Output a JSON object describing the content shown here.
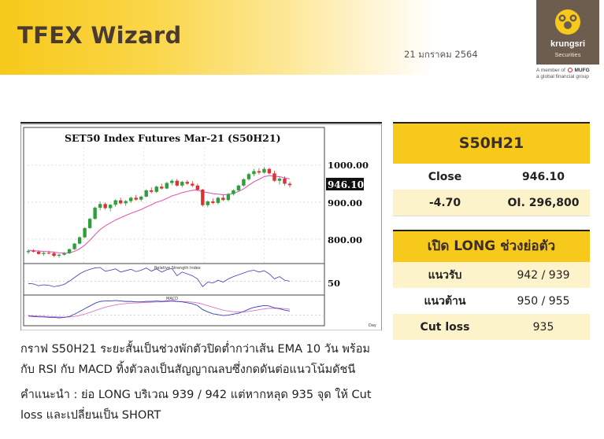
{
  "header": {
    "title": "TFEX Wizard",
    "date": "21 มกราคม 2564"
  },
  "logo": {
    "name": "krungsri",
    "sub": "Securities",
    "mufg_line1": "A member of",
    "mufg_brand": "MUFG",
    "mufg_line2": "a global financial group"
  },
  "chart": {
    "title": "SET50  Index  Futures  Mar-21  (S50H21)",
    "price_labels": [
      "1000.00",
      "900.00",
      "800.00"
    ],
    "last_price_tag": "946.10",
    "rsi_label": "Relative Strength Index",
    "rsi_level": "50",
    "macd_label": "MACD",
    "axis_end_label": "Day",
    "colors": {
      "up": "#2e9f3a",
      "down": "#d93333",
      "ema": "#e05ab8",
      "macd": "#3b3fb5",
      "signal": "#d977c6"
    }
  },
  "chart_data": {
    "type": "candlestick",
    "title": "SET50  Index  Futures  Mar-21  (S50H21)",
    "y_ticks": [
      1000,
      900,
      800
    ],
    "last": 946.1,
    "ohlc": [
      [
        765,
        772,
        760,
        768
      ],
      [
        768,
        773,
        764,
        766
      ],
      [
        766,
        770,
        758,
        760
      ],
      [
        760,
        766,
        755,
        763
      ],
      [
        763,
        769,
        759,
        762
      ],
      [
        762,
        766,
        752,
        755
      ],
      [
        755,
        761,
        750,
        758
      ],
      [
        758,
        765,
        755,
        762
      ],
      [
        762,
        775,
        760,
        773
      ],
      [
        773,
        790,
        771,
        788
      ],
      [
        788,
        808,
        786,
        805
      ],
      [
        805,
        832,
        803,
        830
      ],
      [
        830,
        858,
        828,
        855
      ],
      [
        855,
        888,
        853,
        885
      ],
      [
        885,
        902,
        878,
        895
      ],
      [
        895,
        900,
        880,
        884
      ],
      [
        884,
        895,
        875,
        893
      ],
      [
        893,
        908,
        888,
        905
      ],
      [
        905,
        912,
        894,
        897
      ],
      [
        897,
        906,
        890,
        903
      ],
      [
        903,
        915,
        898,
        912
      ],
      [
        912,
        920,
        904,
        907
      ],
      [
        907,
        918,
        902,
        915
      ],
      [
        915,
        935,
        913,
        932
      ],
      [
        932,
        940,
        924,
        928
      ],
      [
        928,
        945,
        925,
        942
      ],
      [
        942,
        950,
        934,
        937
      ],
      [
        937,
        955,
        935,
        952
      ],
      [
        952,
        962,
        946,
        958
      ],
      [
        958,
        963,
        942,
        945
      ],
      [
        945,
        958,
        940,
        955
      ],
      [
        955,
        960,
        947,
        950
      ],
      [
        950,
        957,
        941,
        945
      ],
      [
        945,
        950,
        930,
        934
      ],
      [
        934,
        936,
        888,
        892
      ],
      [
        892,
        905,
        886,
        902
      ],
      [
        902,
        910,
        895,
        898
      ],
      [
        898,
        915,
        894,
        912
      ],
      [
        912,
        920,
        903,
        906
      ],
      [
        906,
        925,
        902,
        922
      ],
      [
        922,
        935,
        918,
        932
      ],
      [
        932,
        948,
        928,
        945
      ],
      [
        945,
        965,
        942,
        962
      ],
      [
        962,
        980,
        958,
        976
      ],
      [
        976,
        990,
        970,
        984
      ],
      [
        984,
        992,
        975,
        980
      ],
      [
        980,
        995,
        977,
        990
      ],
      [
        990,
        993,
        975,
        978
      ],
      [
        978,
        985,
        955,
        958
      ],
      [
        958,
        968,
        948,
        964
      ],
      [
        964,
        970,
        945,
        950
      ],
      [
        950,
        955,
        940,
        946.1
      ]
    ],
    "ema10": [
      770,
      769,
      768,
      767,
      766,
      765,
      763,
      762,
      763,
      767,
      774,
      784,
      797,
      812,
      826,
      836,
      844,
      852,
      858,
      864,
      870,
      875,
      880,
      887,
      893,
      900,
      904,
      910,
      917,
      921,
      926,
      929,
      932,
      933,
      928,
      926,
      923,
      922,
      920,
      921,
      924,
      929,
      936,
      946,
      955,
      962,
      969,
      972,
      970,
      969,
      966,
      963
    ],
    "rsi": [
      45,
      44,
      40,
      42,
      41,
      38,
      40,
      43,
      50,
      58,
      66,
      72,
      76,
      79,
      80,
      72,
      74,
      77,
      70,
      73,
      76,
      71,
      74,
      79,
      72,
      77,
      70,
      75,
      78,
      62,
      70,
      66,
      62,
      55,
      38,
      48,
      46,
      52,
      48,
      55,
      60,
      64,
      68,
      72,
      74,
      70,
      73,
      66,
      55,
      60,
      52,
      50
    ],
    "macd": [
      -2,
      -3,
      -4,
      -4,
      -5,
      -5,
      -6,
      -5,
      -3,
      2,
      8,
      14,
      20,
      26,
      30,
      31,
      31,
      32,
      31,
      30,
      30,
      29,
      29,
      30,
      30,
      31,
      30,
      31,
      32,
      30,
      29,
      27,
      25,
      21,
      12,
      7,
      3,
      1,
      -1,
      0,
      2,
      4,
      8,
      13,
      17,
      19,
      21,
      20,
      16,
      14,
      11,
      9
    ],
    "signal": [
      -1,
      -1.5,
      -2,
      -2.5,
      -3,
      -3.5,
      -4,
      -4.3,
      -4.2,
      -3,
      -0.8,
      2.2,
      5.8,
      9.8,
      13.8,
      17.2,
      19.9,
      22.3,
      24,
      25.2,
      26.2,
      26.7,
      27.2,
      27.8,
      28.2,
      28.8,
      29,
      29.4,
      29.9,
      29.9,
      29.7,
      29.2,
      28.4,
      26.9,
      24,
      20.6,
      17.1,
      13.9,
      10.9,
      8.7,
      7.4,
      6.7,
      7,
      8.2,
      9.9,
      11.7,
      13.6,
      14.9,
      15.1,
      14.9,
      14.1,
      13.1
    ]
  },
  "quote_panel": {
    "symbol": "S50H21",
    "close_label": "Close",
    "close_value": "946.10",
    "change": "-4.70",
    "oi": "OI. 296,800"
  },
  "strategy_panel": {
    "title": "เปิด LONG ช่วงย่อตัว",
    "rows": [
      {
        "label": "แนวรับ",
        "value": "942 / 939"
      },
      {
        "label": "แนวต้าน",
        "value": "950 / 955"
      },
      {
        "label": "Cut loss",
        "value": "935"
      }
    ]
  },
  "commentary": {
    "line1": "กราฟ S50H21 ระยะสั้นเป็นช่วงพักตัวปิดต่ำกว่าเส้น EMA 10 วัน พร้อม",
    "line2": "กับ RSI กับ MACD ทิ้งตัวลงเป็นสัญญาณลบซึ่งกดดันต่อแนวโน้มดัชนี",
    "line3": "คำแนะนำ : ย่อ LONG บริเวณ 939 / 942 แต่หากหลุด 935 จุด ให้ Cut",
    "line4": "loss และเปลี่ยนเป็น SHORT"
  }
}
